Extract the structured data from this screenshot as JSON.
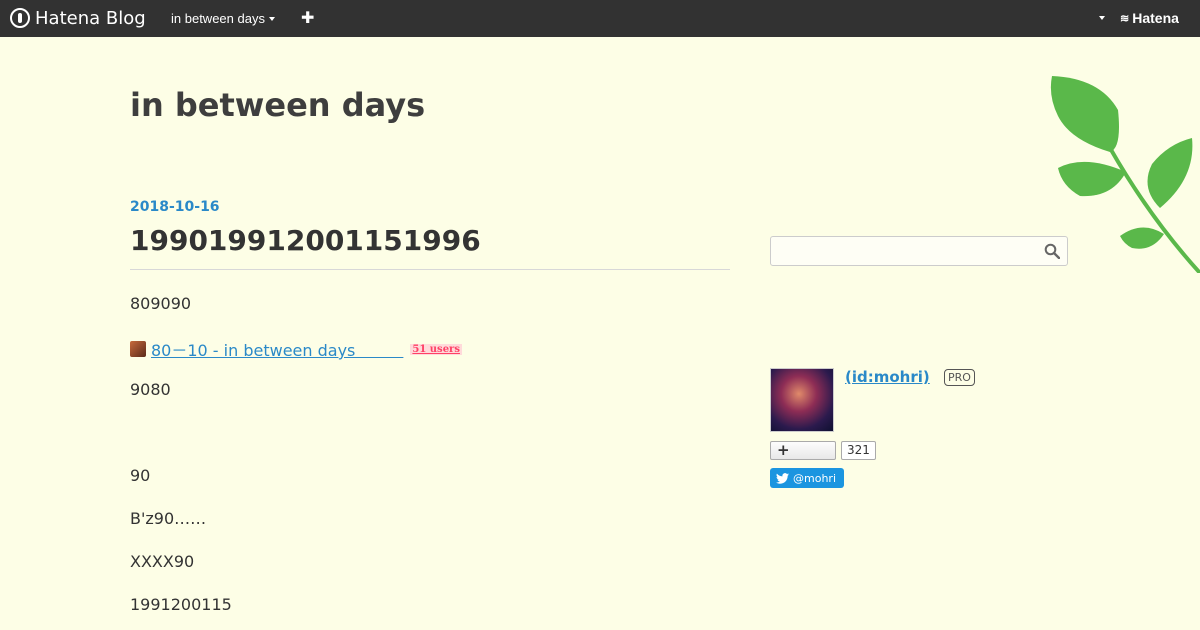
{
  "globalbar": {
    "logo_text": "Hatena Blog",
    "blog_name": "in between days",
    "add_label": "✚",
    "hatena_label": "Hatena"
  },
  "header": {
    "blog_title": "in between days"
  },
  "entry": {
    "date": "2018-10-16",
    "title": "199019912001151996",
    "paragraphs": {
      "p1": "809090",
      "p3": "9080",
      "p4": "90",
      "p5": "B'z90……",
      "p6": "XXXX90",
      "p7": "1991200115"
    },
    "link": {
      "text": "80－10 - in between days　　　",
      "users": "51 users"
    }
  },
  "sidebar": {
    "search": {
      "placeholder": ""
    },
    "profile": {
      "name": " (id:mohri)",
      "badge": "PRO",
      "follow_count": "321",
      "twitter_handle": "@mohri"
    }
  },
  "colors": {
    "background": "#fdfee6",
    "globalbar": "#323232",
    "accent": "#2a89c8",
    "leaf": "#5ab84a",
    "twitter": "#1b95e0"
  }
}
